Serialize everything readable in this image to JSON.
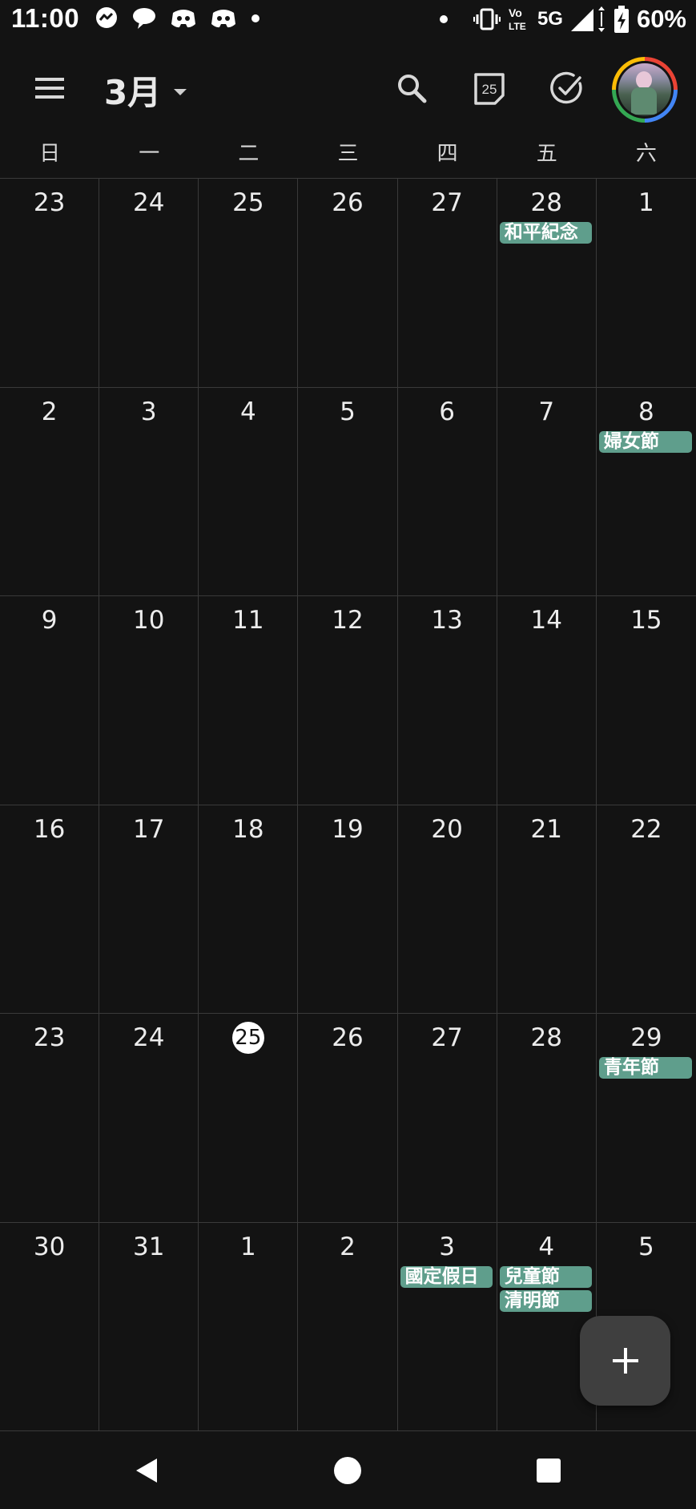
{
  "status_bar": {
    "time": "11:00",
    "network": "5G",
    "battery": "60%"
  },
  "app_bar": {
    "month_title": "3月",
    "today_icon_date": "25"
  },
  "weekdays": [
    "日",
    "一",
    "二",
    "三",
    "四",
    "五",
    "六"
  ],
  "calendar": {
    "weeks": [
      {
        "days": [
          {
            "date": "23",
            "events": []
          },
          {
            "date": "24",
            "events": []
          },
          {
            "date": "25",
            "events": []
          },
          {
            "date": "26",
            "events": []
          },
          {
            "date": "27",
            "events": []
          },
          {
            "date": "28",
            "events": [
              "和平紀念"
            ]
          },
          {
            "date": "1",
            "events": []
          }
        ]
      },
      {
        "days": [
          {
            "date": "2",
            "events": []
          },
          {
            "date": "3",
            "events": []
          },
          {
            "date": "4",
            "events": []
          },
          {
            "date": "5",
            "events": []
          },
          {
            "date": "6",
            "events": []
          },
          {
            "date": "7",
            "events": []
          },
          {
            "date": "8",
            "events": [
              "婦女節"
            ]
          }
        ]
      },
      {
        "days": [
          {
            "date": "9",
            "events": []
          },
          {
            "date": "10",
            "events": []
          },
          {
            "date": "11",
            "events": []
          },
          {
            "date": "12",
            "events": []
          },
          {
            "date": "13",
            "events": []
          },
          {
            "date": "14",
            "events": []
          },
          {
            "date": "15",
            "events": []
          }
        ]
      },
      {
        "days": [
          {
            "date": "16",
            "events": []
          },
          {
            "date": "17",
            "events": []
          },
          {
            "date": "18",
            "events": []
          },
          {
            "date": "19",
            "events": []
          },
          {
            "date": "20",
            "events": []
          },
          {
            "date": "21",
            "events": []
          },
          {
            "date": "22",
            "events": []
          }
        ]
      },
      {
        "days": [
          {
            "date": "23",
            "events": []
          },
          {
            "date": "24",
            "events": []
          },
          {
            "date": "25",
            "events": [],
            "today": true
          },
          {
            "date": "26",
            "events": []
          },
          {
            "date": "27",
            "events": []
          },
          {
            "date": "28",
            "events": []
          },
          {
            "date": "29",
            "events": [
              "青年節"
            ]
          }
        ]
      },
      {
        "days": [
          {
            "date": "30",
            "events": []
          },
          {
            "date": "31",
            "events": []
          },
          {
            "date": "1",
            "events": []
          },
          {
            "date": "2",
            "events": []
          },
          {
            "date": "3",
            "events": [
              "國定假日"
            ]
          },
          {
            "date": "4",
            "events": [
              "兒童節",
              "清明節"
            ]
          },
          {
            "date": "5",
            "events": []
          }
        ]
      }
    ]
  },
  "colors": {
    "background": "#131313",
    "event": "#5f9e8c",
    "grid_line": "#3a3a3a"
  },
  "icons": {
    "status_left": [
      "messenger-icon",
      "chat-bubble-icon",
      "discord-icon",
      "discord-icon",
      "dot-icon"
    ],
    "status_right": [
      "dot-icon",
      "vibrate-icon",
      "volte-icon",
      "signal-icon",
      "battery-charging-icon"
    ],
    "app_bar": [
      "menu-icon",
      "dropdown-caret-icon",
      "search-icon",
      "today-icon",
      "tasks-check-icon",
      "avatar"
    ],
    "fab": "plus-icon",
    "nav": [
      "back-icon",
      "home-icon",
      "recents-icon"
    ]
  }
}
